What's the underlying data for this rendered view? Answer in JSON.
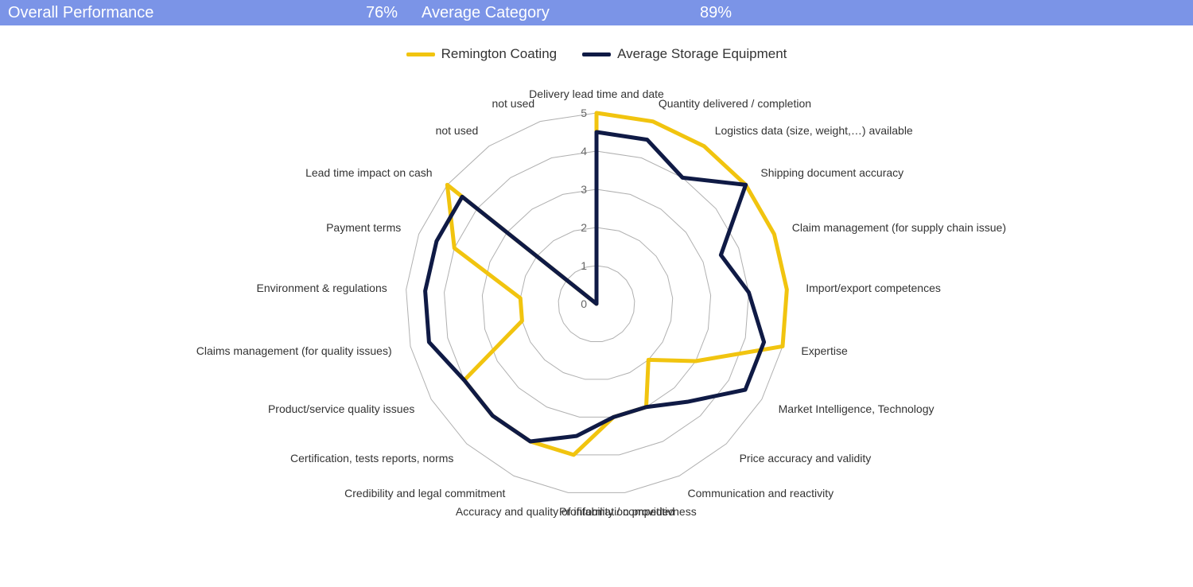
{
  "topbar": {
    "overall_label": "Overall Performance",
    "overall_value": "76%",
    "avgcat_label": "Average Category",
    "avgcat_value": "89%"
  },
  "legend": {
    "series_a": "Remington Coating",
    "series_b": "Average Storage Equipment"
  },
  "colors": {
    "series_a": "#f1c40f",
    "series_b": "#0f1a45"
  },
  "chart_data": {
    "type": "radar",
    "categories": [
      "Delivery lead time and date",
      "Quantity delivered / completion",
      "Logistics data (size, weight,…) available",
      "Shipping document accuracy",
      "Claim management (for supply chain issue)",
      "Import/export competences",
      "Expertise",
      "Market Intelligence, Technology",
      "Price accuracy and validity",
      "Communication and reactivity",
      "Profitability / competitivness",
      "Accuracy and quality of information provided",
      "Credibility and legal commitment",
      "Certification, tests reports, norms",
      "Product/service quality issues",
      "Claims management (for quality issues)",
      "Environment & regulations",
      "Payment terms",
      "Lead time impact on cash",
      "not used",
      "not used"
    ],
    "series": [
      {
        "name": "Remington Coating",
        "color": "#f1c40f",
        "values": [
          5.0,
          5.0,
          5.0,
          5.0,
          5.0,
          5.0,
          5.0,
          3.0,
          2.0,
          3.0,
          3.0,
          4.0,
          4.0,
          4.0,
          4.0,
          2.0,
          2.0,
          4.0,
          5.0,
          0.0,
          0.0
        ]
      },
      {
        "name": "Average Storage Equipment",
        "color": "#0f1a45",
        "values": [
          4.5,
          4.5,
          4.0,
          5.0,
          3.5,
          4.0,
          4.5,
          4.5,
          3.5,
          3.0,
          3.0,
          3.5,
          4.0,
          4.0,
          4.0,
          4.5,
          4.5,
          4.5,
          4.5,
          0.0,
          0.0
        ]
      }
    ],
    "r_ticks": [
      0,
      1,
      2,
      3,
      4,
      5
    ],
    "r_max": 5
  }
}
